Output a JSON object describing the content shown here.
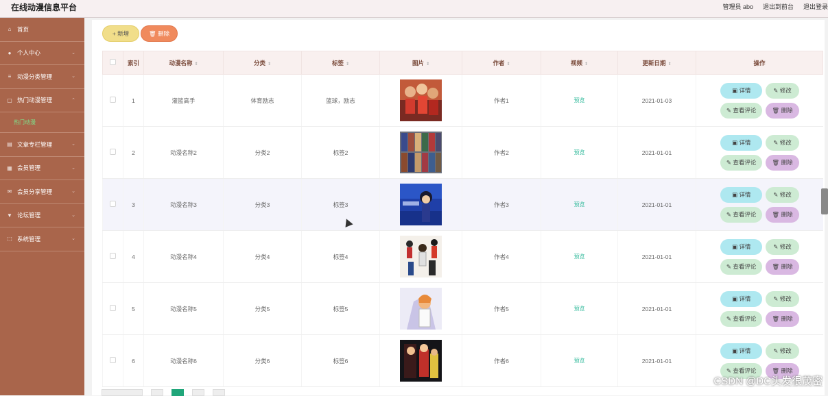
{
  "header": {
    "title": "在线动漫信息平台",
    "links": [
      "管理员 abo",
      "退出到前台",
      "退出登录"
    ]
  },
  "sidebar": {
    "items": [
      {
        "label": "首页",
        "icon": "home-icon",
        "chevron": false
      },
      {
        "label": "个人中心",
        "icon": "user-icon",
        "chevron": true
      },
      {
        "label": "动漫分类管理",
        "icon": "list-icon",
        "chevron": true
      },
      {
        "label": "热门动漫管理",
        "icon": "folder-icon",
        "chevron": true
      }
    ],
    "sub_item": "热门动漫",
    "items2": [
      {
        "label": "文章专栏管理",
        "icon": "article-icon",
        "chevron": true
      },
      {
        "label": "会员管理",
        "icon": "members-icon",
        "chevron": true
      },
      {
        "label": "会员分享管理",
        "icon": "mail-icon",
        "chevron": true
      },
      {
        "label": "论坛管理",
        "icon": "forum-icon",
        "chevron": true
      },
      {
        "label": "系统管理",
        "icon": "system-icon",
        "chevron": true
      }
    ]
  },
  "toolbar": {
    "add_label": "+ 新增",
    "delete_label": "🗑 删除"
  },
  "table": {
    "headers": [
      "索引",
      "动漫名称",
      "分类",
      "标签",
      "图片",
      "作者",
      "视频",
      "更新日期",
      "操作"
    ],
    "rows": [
      {
        "index": "1",
        "name": "灌篮高手",
        "category": "体育励志",
        "tags": "篮球，励志",
        "author": "作者1",
        "video": "预览",
        "date": "2021-01-03"
      },
      {
        "index": "2",
        "name": "动漫名称2",
        "category": "分类2",
        "tags": "标签2",
        "author": "作者2",
        "video": "预览",
        "date": "2021-01-01"
      },
      {
        "index": "3",
        "name": "动漫名称3",
        "category": "分类3",
        "tags": "标签3",
        "author": "作者3",
        "video": "预览",
        "date": "2021-01-01"
      },
      {
        "index": "4",
        "name": "动漫名称4",
        "category": "分类4",
        "tags": "标签4",
        "author": "作者4",
        "video": "预览",
        "date": "2021-01-01"
      },
      {
        "index": "5",
        "name": "动漫名称5",
        "category": "分类5",
        "tags": "标签5",
        "author": "作者5",
        "video": "预览",
        "date": "2021-01-01"
      },
      {
        "index": "6",
        "name": "动漫名称6",
        "category": "分类6",
        "tags": "标签6",
        "author": "作者6",
        "video": "预览",
        "date": "2021-01-01"
      }
    ],
    "op_labels": {
      "detail": "详情",
      "edit": "修改",
      "comments": "查看评论",
      "delete": "删除"
    }
  },
  "watermark": "CSDN @DC头发很茂密",
  "colors": {
    "sidebar": "#a9654b",
    "accent_green": "#20a67a",
    "preview_text": "#2fb99a"
  }
}
